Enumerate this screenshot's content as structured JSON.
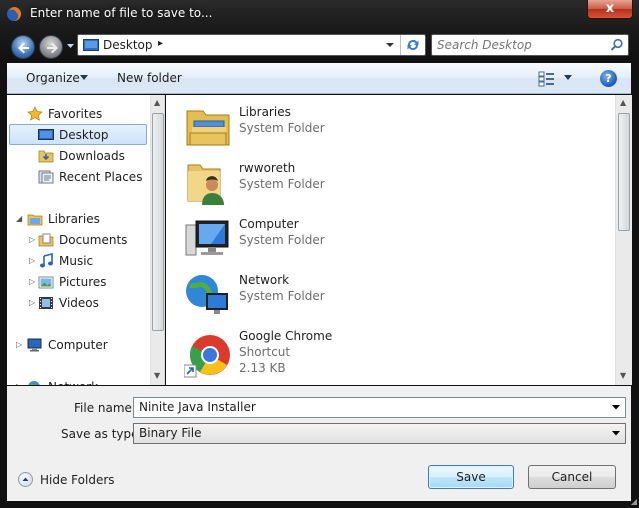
{
  "window": {
    "title": "Enter name of file to save to...",
    "close_label": "x"
  },
  "navbar": {
    "address": "Desktop",
    "address_separator": "▸",
    "search_placeholder": "Search Desktop"
  },
  "toolbar": {
    "organize_label": "Organize",
    "new_folder_label": "New folder",
    "help_label": "?"
  },
  "sidebar": {
    "favorites_label": "Favorites",
    "favorites": [
      {
        "label": "Desktop",
        "icon": "desktop-icon",
        "selected": true
      },
      {
        "label": "Downloads",
        "icon": "downloads-icon"
      },
      {
        "label": "Recent Places",
        "icon": "recent-places-icon"
      }
    ],
    "libraries_label": "Libraries",
    "libraries": [
      {
        "label": "Documents",
        "icon": "documents-icon"
      },
      {
        "label": "Music",
        "icon": "music-icon"
      },
      {
        "label": "Pictures",
        "icon": "pictures-icon"
      },
      {
        "label": "Videos",
        "icon": "videos-icon"
      }
    ],
    "computer_label": "Computer",
    "network_label": "Network"
  },
  "files": [
    {
      "name": "Libraries",
      "type": "System Folder",
      "icon": "libraries-folder-icon"
    },
    {
      "name": "rwworeth",
      "type": "System Folder",
      "icon": "user-folder-icon"
    },
    {
      "name": "Computer",
      "type": "System Folder",
      "icon": "computer-icon"
    },
    {
      "name": "Network",
      "type": "System Folder",
      "icon": "network-icon"
    },
    {
      "name": "Google Chrome",
      "type": "Shortcut",
      "size": "2.13 KB",
      "icon": "chrome-icon"
    }
  ],
  "form": {
    "file_name_label": "File name:",
    "file_name_value": "Ninite Java Installer",
    "save_type_label": "Save as type:",
    "save_type_value": "Binary File"
  },
  "footer": {
    "hide_folders_label": "Hide Folders",
    "save_label": "Save",
    "cancel_label": "Cancel"
  }
}
